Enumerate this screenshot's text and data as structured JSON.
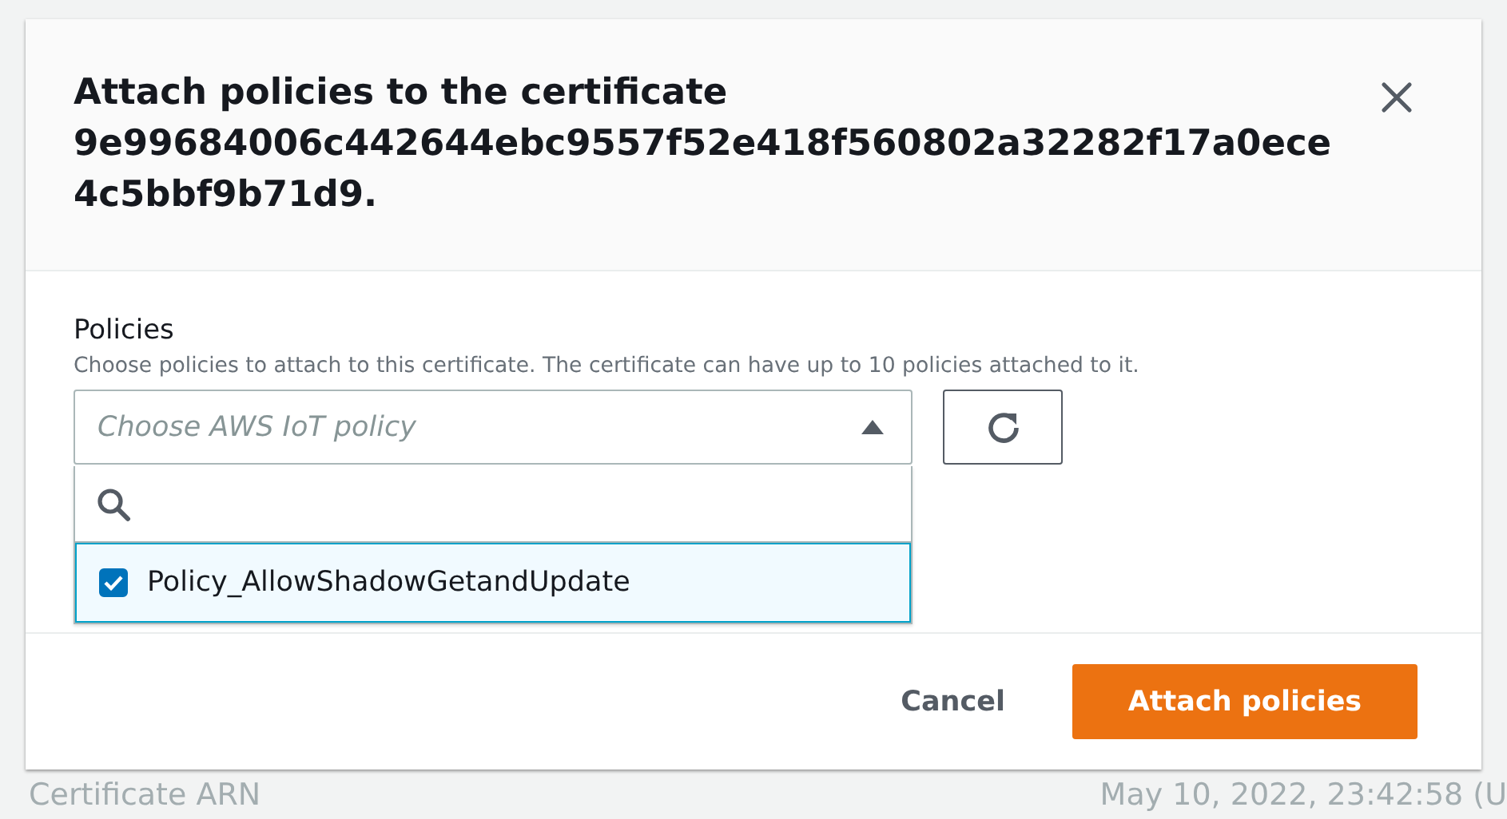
{
  "background": {
    "label": "Certificate ARN",
    "date": "May 10, 2022, 23:42:58 (U"
  },
  "dialog": {
    "title": "Attach policies to the certificate 9e99684006c442644ebc9557f52e418f560802a32282f17a0ece4c5bbf9b71d9.",
    "field": {
      "label": "Policies",
      "description": "Choose policies to attach to this certificate. The certificate can have up to 10 policies attached to it.",
      "placeholder": "Choose AWS IoT policy",
      "expanded": true
    },
    "options": [
      {
        "label": "Policy_AllowShadowGetandUpdate",
        "checked": true,
        "selected": true
      }
    ],
    "buttons": [
      {
        "label": "Cancel",
        "kind": "link"
      },
      {
        "label": "Attach policies",
        "kind": "primary"
      }
    ]
  }
}
